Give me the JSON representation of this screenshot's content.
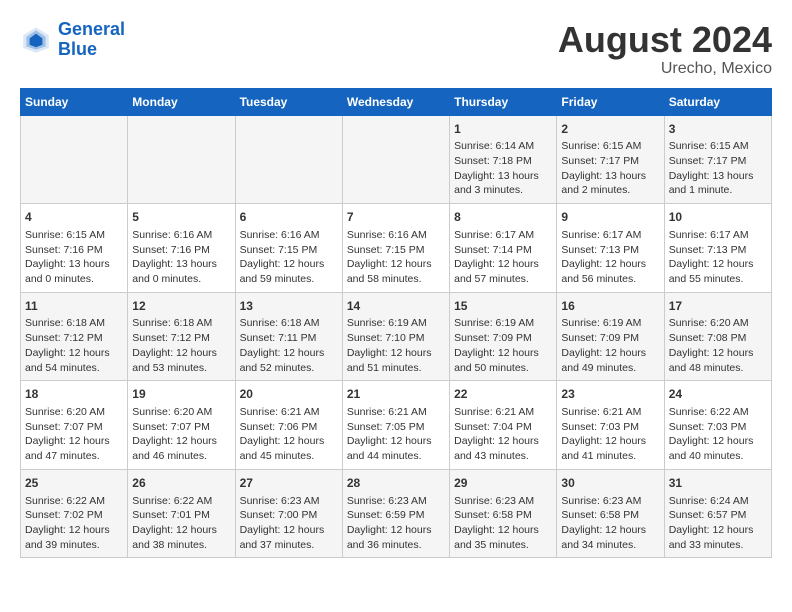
{
  "header": {
    "logo_line1": "General",
    "logo_line2": "Blue",
    "title": "August 2024",
    "subtitle": "Urecho, Mexico"
  },
  "calendar": {
    "days_of_week": [
      "Sunday",
      "Monday",
      "Tuesday",
      "Wednesday",
      "Thursday",
      "Friday",
      "Saturday"
    ],
    "weeks": [
      [
        {
          "day": "",
          "content": ""
        },
        {
          "day": "",
          "content": ""
        },
        {
          "day": "",
          "content": ""
        },
        {
          "day": "",
          "content": ""
        },
        {
          "day": "1",
          "content": "Sunrise: 6:14 AM\nSunset: 7:18 PM\nDaylight: 13 hours\nand 3 minutes."
        },
        {
          "day": "2",
          "content": "Sunrise: 6:15 AM\nSunset: 7:17 PM\nDaylight: 13 hours\nand 2 minutes."
        },
        {
          "day": "3",
          "content": "Sunrise: 6:15 AM\nSunset: 7:17 PM\nDaylight: 13 hours\nand 1 minute."
        }
      ],
      [
        {
          "day": "4",
          "content": "Sunrise: 6:15 AM\nSunset: 7:16 PM\nDaylight: 13 hours\nand 0 minutes."
        },
        {
          "day": "5",
          "content": "Sunrise: 6:16 AM\nSunset: 7:16 PM\nDaylight: 13 hours\nand 0 minutes."
        },
        {
          "day": "6",
          "content": "Sunrise: 6:16 AM\nSunset: 7:15 PM\nDaylight: 12 hours\nand 59 minutes."
        },
        {
          "day": "7",
          "content": "Sunrise: 6:16 AM\nSunset: 7:15 PM\nDaylight: 12 hours\nand 58 minutes."
        },
        {
          "day": "8",
          "content": "Sunrise: 6:17 AM\nSunset: 7:14 PM\nDaylight: 12 hours\nand 57 minutes."
        },
        {
          "day": "9",
          "content": "Sunrise: 6:17 AM\nSunset: 7:13 PM\nDaylight: 12 hours\nand 56 minutes."
        },
        {
          "day": "10",
          "content": "Sunrise: 6:17 AM\nSunset: 7:13 PM\nDaylight: 12 hours\nand 55 minutes."
        }
      ],
      [
        {
          "day": "11",
          "content": "Sunrise: 6:18 AM\nSunset: 7:12 PM\nDaylight: 12 hours\nand 54 minutes."
        },
        {
          "day": "12",
          "content": "Sunrise: 6:18 AM\nSunset: 7:12 PM\nDaylight: 12 hours\nand 53 minutes."
        },
        {
          "day": "13",
          "content": "Sunrise: 6:18 AM\nSunset: 7:11 PM\nDaylight: 12 hours\nand 52 minutes."
        },
        {
          "day": "14",
          "content": "Sunrise: 6:19 AM\nSunset: 7:10 PM\nDaylight: 12 hours\nand 51 minutes."
        },
        {
          "day": "15",
          "content": "Sunrise: 6:19 AM\nSunset: 7:09 PM\nDaylight: 12 hours\nand 50 minutes."
        },
        {
          "day": "16",
          "content": "Sunrise: 6:19 AM\nSunset: 7:09 PM\nDaylight: 12 hours\nand 49 minutes."
        },
        {
          "day": "17",
          "content": "Sunrise: 6:20 AM\nSunset: 7:08 PM\nDaylight: 12 hours\nand 48 minutes."
        }
      ],
      [
        {
          "day": "18",
          "content": "Sunrise: 6:20 AM\nSunset: 7:07 PM\nDaylight: 12 hours\nand 47 minutes."
        },
        {
          "day": "19",
          "content": "Sunrise: 6:20 AM\nSunset: 7:07 PM\nDaylight: 12 hours\nand 46 minutes."
        },
        {
          "day": "20",
          "content": "Sunrise: 6:21 AM\nSunset: 7:06 PM\nDaylight: 12 hours\nand 45 minutes."
        },
        {
          "day": "21",
          "content": "Sunrise: 6:21 AM\nSunset: 7:05 PM\nDaylight: 12 hours\nand 44 minutes."
        },
        {
          "day": "22",
          "content": "Sunrise: 6:21 AM\nSunset: 7:04 PM\nDaylight: 12 hours\nand 43 minutes."
        },
        {
          "day": "23",
          "content": "Sunrise: 6:21 AM\nSunset: 7:03 PM\nDaylight: 12 hours\nand 41 minutes."
        },
        {
          "day": "24",
          "content": "Sunrise: 6:22 AM\nSunset: 7:03 PM\nDaylight: 12 hours\nand 40 minutes."
        }
      ],
      [
        {
          "day": "25",
          "content": "Sunrise: 6:22 AM\nSunset: 7:02 PM\nDaylight: 12 hours\nand 39 minutes."
        },
        {
          "day": "26",
          "content": "Sunrise: 6:22 AM\nSunset: 7:01 PM\nDaylight: 12 hours\nand 38 minutes."
        },
        {
          "day": "27",
          "content": "Sunrise: 6:23 AM\nSunset: 7:00 PM\nDaylight: 12 hours\nand 37 minutes."
        },
        {
          "day": "28",
          "content": "Sunrise: 6:23 AM\nSunset: 6:59 PM\nDaylight: 12 hours\nand 36 minutes."
        },
        {
          "day": "29",
          "content": "Sunrise: 6:23 AM\nSunset: 6:58 PM\nDaylight: 12 hours\nand 35 minutes."
        },
        {
          "day": "30",
          "content": "Sunrise: 6:23 AM\nSunset: 6:58 PM\nDaylight: 12 hours\nand 34 minutes."
        },
        {
          "day": "31",
          "content": "Sunrise: 6:24 AM\nSunset: 6:57 PM\nDaylight: 12 hours\nand 33 minutes."
        }
      ]
    ]
  }
}
